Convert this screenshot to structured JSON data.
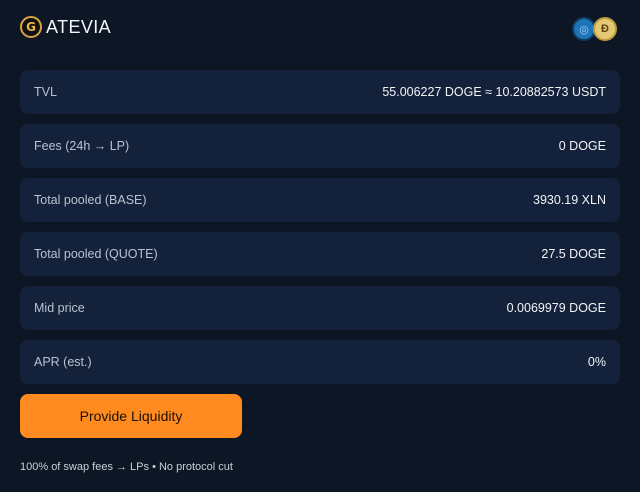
{
  "header": {
    "logo_glyph": "G",
    "brand": "ATEVIA",
    "token_icons": [
      {
        "name": "xln-token-icon",
        "glyph": "◎",
        "color": "#1f73b7"
      },
      {
        "name": "doge-token-icon",
        "glyph": "Ð",
        "color": "#e4c873"
      }
    ]
  },
  "stats": [
    {
      "label": "TVL",
      "value": "55.006227 DOGE ≈ 10.20882573 USDT"
    },
    {
      "label": "Fees (24h → LP)",
      "value": "0 DOGE"
    },
    {
      "label": "Total pooled (BASE)",
      "value": "3930.19 XLN"
    },
    {
      "label": "Total pooled (QUOTE)",
      "value": "27.5 DOGE"
    },
    {
      "label": "Mid price",
      "value": "0.0069979 DOGE"
    },
    {
      "label": "APR (est.)",
      "value": "0%"
    }
  ],
  "actions": {
    "provide_liquidity": "Provide Liquidity"
  },
  "footnote": "100% of swap fees → LPs • No protocol cut",
  "colors": {
    "background": "#0d1625",
    "card": "#14213a",
    "accent": "#ff8a1f"
  }
}
